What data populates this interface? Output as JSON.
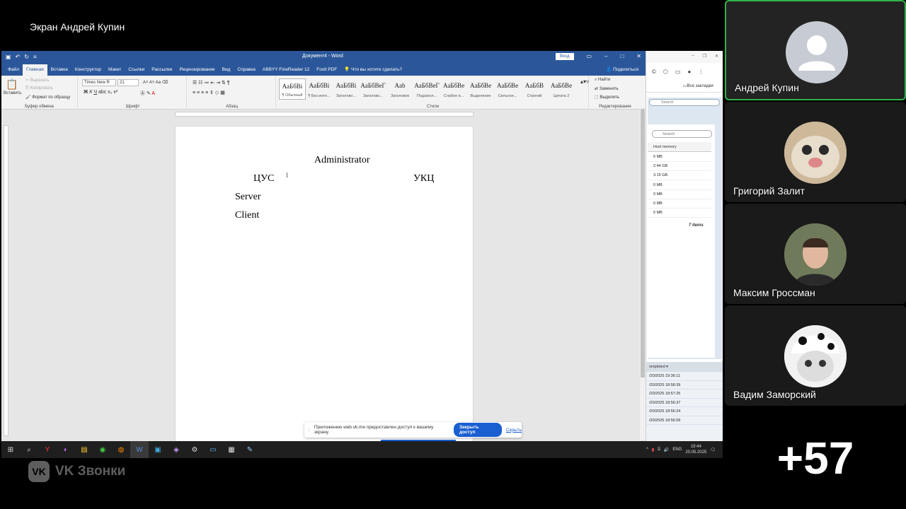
{
  "call": {
    "share_title": "Экран Андрей Купин",
    "brand": "VK Звонки",
    "brand_mark": "VK",
    "more_participants": "+57"
  },
  "participants": [
    {
      "name": "Андрей Купин",
      "speaking": true
    },
    {
      "name": "Григорий Залит",
      "speaking": false
    },
    {
      "name": "Максим Гроссман",
      "speaking": false
    },
    {
      "name": "Вадим Заморский",
      "speaking": false
    }
  ],
  "word": {
    "title": "Документ4 - Word",
    "signin": "Вход",
    "tabs": [
      "Файл",
      "Главная",
      "Вставка",
      "Конструктор",
      "Макет",
      "Ссылки",
      "Рассылки",
      "Рецензирование",
      "Вид",
      "Справка",
      "ABBYY FineReader 12",
      "Foxit PDF",
      "Что вы хотите сделать?"
    ],
    "share": "Поделиться",
    "clipboard": {
      "paste": "Вставить",
      "cut": "Вырезать",
      "copy": "Копировать",
      "format_painter": "Формат по образцу",
      "label": "Буфер обмена"
    },
    "font": {
      "name": "Times New R",
      "size": "21",
      "label": "Шрифт"
    },
    "paragraph_label": "Абзац",
    "styles_label": "Стили",
    "styles": [
      {
        "preview": "АаБбВі",
        "name": "¶ Обычный",
        "selected": true
      },
      {
        "preview": "АаБбВі",
        "name": "¶ Без инте...",
        "selected": false
      },
      {
        "preview": "АаБбВі",
        "name": "Заголово...",
        "selected": false
      },
      {
        "preview": "АаБбВеГ",
        "name": "Заголово...",
        "selected": false
      },
      {
        "preview": "Aab",
        "name": "Заголовок",
        "selected": false
      },
      {
        "preview": "АаБбВеГ",
        "name": "Подзагол...",
        "selected": false
      },
      {
        "preview": "АаБбВе",
        "name": "Слабое в...",
        "selected": false
      },
      {
        "preview": "АаБбВе",
        "name": "Выделение",
        "selected": false
      },
      {
        "preview": "АаБбВе",
        "name": "Сильное...",
        "selected": false
      },
      {
        "preview": "АаБбВ",
        "name": "Строгий",
        "selected": false
      },
      {
        "preview": "АаБбВе",
        "name": "Цитата 2",
        "selected": false
      }
    ],
    "editing": {
      "find": "Найти",
      "replace": "Заменить",
      "select": "Выделить",
      "label": "Редактирование"
    },
    "document": {
      "line1": "Administrator",
      "line2_left": "ЦУС",
      "line2_right": "УКЦ",
      "line3": "Server",
      "line4": "Client"
    }
  },
  "browser": {
    "bookmarks": "Все закладки",
    "search_top": "Search",
    "search_panel": "Search",
    "column": "Host memory",
    "memory_rows": [
      "0 MB",
      "2.44 GB",
      "3.15 GB",
      "0 MB",
      "0 MB",
      "0 MB",
      "0 MB"
    ],
    "items_count": "7 items",
    "tasks_header": "ompleted ▾",
    "task_times": [
      "/20/2025 19:36:11",
      "/20/2025 18:58:39",
      "/20/2025 18:57:25",
      "/20/2025 18:56:37",
      "/20/2025 18:56:24",
      "/20/2025 18:56:09"
    ]
  },
  "banner": {
    "text": "Приложению web.vk.me предоставлен доступ к вашему экрану.",
    "stop": "Закрыть доступ",
    "hide": "Скрыть"
  },
  "taskbar": {
    "lang": "ENG",
    "time": "19:44",
    "date": "20.05.2025"
  },
  "colors": {
    "word_blue": "#2b579a",
    "speaking_border": "#2fb34a",
    "accent": "#1a5fd1"
  }
}
